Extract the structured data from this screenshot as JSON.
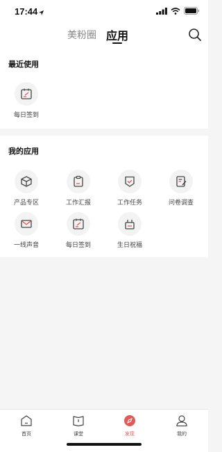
{
  "status": {
    "time": "17:44"
  },
  "header": {
    "tabs": [
      {
        "label": "美粉圈",
        "active": false
      },
      {
        "label": "应用",
        "active": true
      }
    ],
    "search_icon": "search-icon"
  },
  "recent": {
    "title": "最近使用",
    "items": [
      {
        "label": "每日签到",
        "icon": "calendar-check-icon"
      }
    ]
  },
  "apps": {
    "title": "我的应用",
    "items": [
      {
        "label": "产品专区",
        "icon": "cube-icon"
      },
      {
        "label": "工作汇报",
        "icon": "clipboard-icon"
      },
      {
        "label": "工作任务",
        "icon": "shield-check-icon"
      },
      {
        "label": "问卷调查",
        "icon": "survey-icon"
      },
      {
        "label": "一线声音",
        "icon": "mail-icon"
      },
      {
        "label": "每日签到",
        "icon": "calendar-check-icon"
      },
      {
        "label": "生日祝福",
        "icon": "cake-icon"
      }
    ]
  },
  "tabbar": {
    "items": [
      {
        "label": "首页",
        "icon": "home-icon",
        "active": false
      },
      {
        "label": "课堂",
        "icon": "book-icon",
        "active": false
      },
      {
        "label": "发现",
        "icon": "compass-icon",
        "active": true
      },
      {
        "label": "我的",
        "icon": "profile-icon",
        "active": false
      }
    ]
  },
  "colors": {
    "accent": "#e05a5a",
    "icon_stroke": "#444444",
    "background": "#f5f5f5"
  }
}
